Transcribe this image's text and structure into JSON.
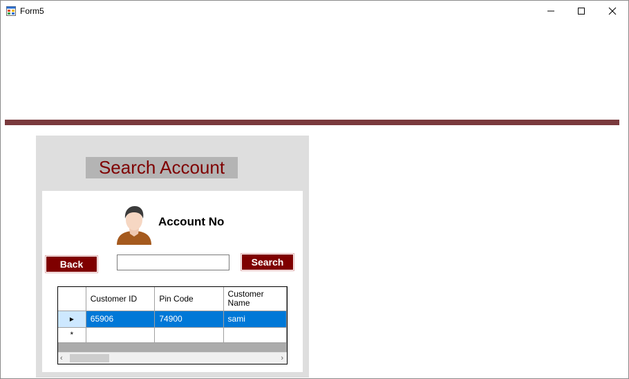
{
  "window": {
    "title": "Form5",
    "icon": "form-app-icon",
    "controls": [
      "minimize-icon",
      "maximize-icon",
      "close-icon"
    ]
  },
  "colors": {
    "accent_dark_red": "#7f0000",
    "divider": "#7a3a3d",
    "panel_bg": "#dedede",
    "heading_bg": "#b4b4b4",
    "selection_blue": "#0078d7"
  },
  "panel": {
    "heading": "Search Account",
    "account_label": "Account No",
    "avatar": "user-avatar-icon",
    "back_label": "Back",
    "search_label": "Search",
    "account_input_value": ""
  },
  "grid": {
    "columns": [
      "Customer ID",
      "Pin Code",
      "Customer Name"
    ],
    "rows": [
      {
        "customer_id": "65906",
        "pin_code": "74900",
        "customer_name": "sami",
        "selected": true
      }
    ],
    "selected_row_marker": "▸",
    "new_row_marker": "*"
  }
}
